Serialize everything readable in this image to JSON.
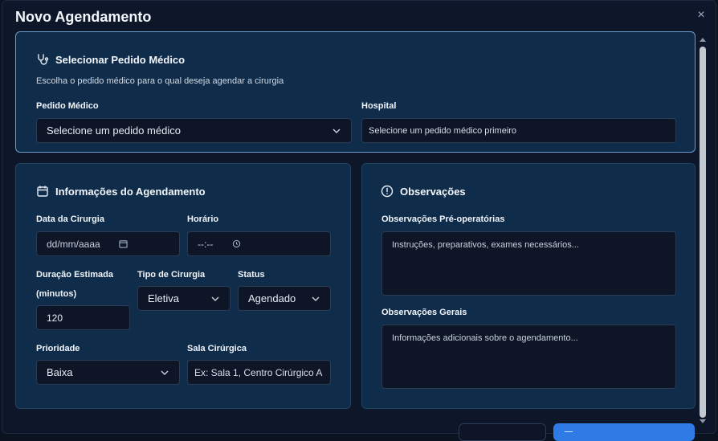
{
  "modal": {
    "title": "Novo Agendamento",
    "close_icon": "×"
  },
  "pedido": {
    "title": "Selecionar Pedido Médico",
    "description": "Escolha o pedido médico para o qual deseja agendar a cirurgia",
    "pedido_label": "Pedido Médico",
    "pedido_value": "Selecione um pedido médico",
    "hospital_label": "Hospital",
    "hospital_value": "Selecione um pedido médico primeiro"
  },
  "agendamento": {
    "title": "Informações do Agendamento",
    "data_label": "Data da Cirurgia",
    "data_value": "dd/mm/aaaa",
    "horario_label": "Horário",
    "horario_value": "--:--",
    "duracao_label_1": "Duração Estimada",
    "duracao_label_2": "(minutos)",
    "duracao_value": "120",
    "tipo_label": "Tipo de Cirurgia",
    "tipo_value": "Eletiva",
    "status_label": "Status",
    "status_value": "Agendado",
    "prioridade_label": "Prioridade",
    "prioridade_value": "Baixa",
    "sala_label": "Sala Cirúrgica",
    "sala_placeholder": "Ex: Sala 1, Centro Cirúrgico A"
  },
  "observacoes": {
    "title": "Observações",
    "preop_label": "Observações Pré-operatórias",
    "preop_placeholder": "Instruções, preparativos, exames necessários...",
    "gerais_label": "Observações Gerais",
    "gerais_placeholder": "Informações adicionais sobre o agendamento..."
  },
  "colors": {
    "card_bg": "#0f2d4b",
    "field_bg": "#0d1526",
    "accent": "#2f7be6",
    "modal_bg": "#0d1729"
  }
}
